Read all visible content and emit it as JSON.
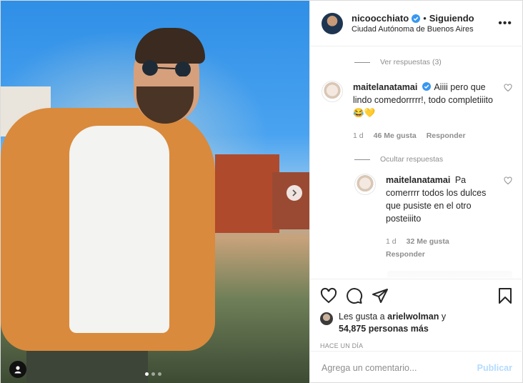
{
  "header": {
    "username": "nicoocchiato",
    "separator": "•",
    "follow_label": "Siguiendo",
    "location": "Ciudad Autónoma de Buenos Aires",
    "more_label": "•••"
  },
  "comments": {
    "view_replies": "Ver respuestas (3)",
    "items": [
      {
        "username": "maitelanatamai",
        "text": "Aiiii pero que lindo comedorrrrr!, todo completiiito 😂💛",
        "age": "1 d",
        "likes": "46 Me gusta",
        "reply_label": "Responder"
      }
    ],
    "hide_replies": "Ocultar respuestas",
    "replies": [
      {
        "username": "maitelanatamai",
        "text": "Pa comerrrr todos los dulces que pusiste en el otro posteiiito",
        "age": "1 d",
        "likes": "32 Me gusta",
        "reply_label": "Responder"
      }
    ]
  },
  "likes": {
    "prefix": "Les gusta a",
    "user": "arielwolman",
    "connector": "y",
    "others": "54,875 personas más"
  },
  "timestamp": "HACE UN DÍA",
  "add_comment": {
    "placeholder": "Agrega un comentario...",
    "publish_label": "Publicar"
  },
  "carousel": {
    "total": 3,
    "active": 0
  },
  "icons": {
    "verified": "verified-badge-icon",
    "heart": "heart-icon",
    "comment": "comment-icon",
    "share": "share-icon",
    "bookmark": "bookmark-icon",
    "next": "chevron-right-icon",
    "user_tag": "user-tag-icon"
  },
  "colors": {
    "verified_blue": "#3897f0",
    "text": "#262626",
    "muted": "#8e8e8e",
    "publish_disabled": "#b3dbff"
  }
}
